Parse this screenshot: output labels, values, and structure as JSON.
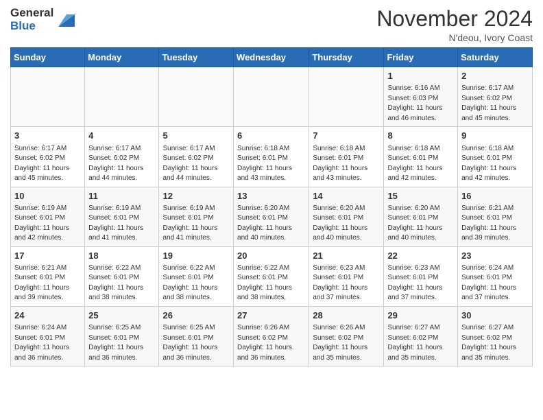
{
  "header": {
    "logo_general": "General",
    "logo_blue": "Blue",
    "month_title": "November 2024",
    "location": "N'deou, Ivory Coast"
  },
  "days_of_week": [
    "Sunday",
    "Monday",
    "Tuesday",
    "Wednesday",
    "Thursday",
    "Friday",
    "Saturday"
  ],
  "weeks": [
    {
      "days": [
        {
          "date": "",
          "info": ""
        },
        {
          "date": "",
          "info": ""
        },
        {
          "date": "",
          "info": ""
        },
        {
          "date": "",
          "info": ""
        },
        {
          "date": "",
          "info": ""
        },
        {
          "date": "1",
          "info": "Sunrise: 6:16 AM\nSunset: 6:03 PM\nDaylight: 11 hours\nand 46 minutes."
        },
        {
          "date": "2",
          "info": "Sunrise: 6:17 AM\nSunset: 6:02 PM\nDaylight: 11 hours\nand 45 minutes."
        }
      ]
    },
    {
      "days": [
        {
          "date": "3",
          "info": "Sunrise: 6:17 AM\nSunset: 6:02 PM\nDaylight: 11 hours\nand 45 minutes."
        },
        {
          "date": "4",
          "info": "Sunrise: 6:17 AM\nSunset: 6:02 PM\nDaylight: 11 hours\nand 44 minutes."
        },
        {
          "date": "5",
          "info": "Sunrise: 6:17 AM\nSunset: 6:02 PM\nDaylight: 11 hours\nand 44 minutes."
        },
        {
          "date": "6",
          "info": "Sunrise: 6:18 AM\nSunset: 6:01 PM\nDaylight: 11 hours\nand 43 minutes."
        },
        {
          "date": "7",
          "info": "Sunrise: 6:18 AM\nSunset: 6:01 PM\nDaylight: 11 hours\nand 43 minutes."
        },
        {
          "date": "8",
          "info": "Sunrise: 6:18 AM\nSunset: 6:01 PM\nDaylight: 11 hours\nand 42 minutes."
        },
        {
          "date": "9",
          "info": "Sunrise: 6:18 AM\nSunset: 6:01 PM\nDaylight: 11 hours\nand 42 minutes."
        }
      ]
    },
    {
      "days": [
        {
          "date": "10",
          "info": "Sunrise: 6:19 AM\nSunset: 6:01 PM\nDaylight: 11 hours\nand 42 minutes."
        },
        {
          "date": "11",
          "info": "Sunrise: 6:19 AM\nSunset: 6:01 PM\nDaylight: 11 hours\nand 41 minutes."
        },
        {
          "date": "12",
          "info": "Sunrise: 6:19 AM\nSunset: 6:01 PM\nDaylight: 11 hours\nand 41 minutes."
        },
        {
          "date": "13",
          "info": "Sunrise: 6:20 AM\nSunset: 6:01 PM\nDaylight: 11 hours\nand 40 minutes."
        },
        {
          "date": "14",
          "info": "Sunrise: 6:20 AM\nSunset: 6:01 PM\nDaylight: 11 hours\nand 40 minutes."
        },
        {
          "date": "15",
          "info": "Sunrise: 6:20 AM\nSunset: 6:01 PM\nDaylight: 11 hours\nand 40 minutes."
        },
        {
          "date": "16",
          "info": "Sunrise: 6:21 AM\nSunset: 6:01 PM\nDaylight: 11 hours\nand 39 minutes."
        }
      ]
    },
    {
      "days": [
        {
          "date": "17",
          "info": "Sunrise: 6:21 AM\nSunset: 6:01 PM\nDaylight: 11 hours\nand 39 minutes."
        },
        {
          "date": "18",
          "info": "Sunrise: 6:22 AM\nSunset: 6:01 PM\nDaylight: 11 hours\nand 38 minutes."
        },
        {
          "date": "19",
          "info": "Sunrise: 6:22 AM\nSunset: 6:01 PM\nDaylight: 11 hours\nand 38 minutes."
        },
        {
          "date": "20",
          "info": "Sunrise: 6:22 AM\nSunset: 6:01 PM\nDaylight: 11 hours\nand 38 minutes."
        },
        {
          "date": "21",
          "info": "Sunrise: 6:23 AM\nSunset: 6:01 PM\nDaylight: 11 hours\nand 37 minutes."
        },
        {
          "date": "22",
          "info": "Sunrise: 6:23 AM\nSunset: 6:01 PM\nDaylight: 11 hours\nand 37 minutes."
        },
        {
          "date": "23",
          "info": "Sunrise: 6:24 AM\nSunset: 6:01 PM\nDaylight: 11 hours\nand 37 minutes."
        }
      ]
    },
    {
      "days": [
        {
          "date": "24",
          "info": "Sunrise: 6:24 AM\nSunset: 6:01 PM\nDaylight: 11 hours\nand 36 minutes."
        },
        {
          "date": "25",
          "info": "Sunrise: 6:25 AM\nSunset: 6:01 PM\nDaylight: 11 hours\nand 36 minutes."
        },
        {
          "date": "26",
          "info": "Sunrise: 6:25 AM\nSunset: 6:01 PM\nDaylight: 11 hours\nand 36 minutes."
        },
        {
          "date": "27",
          "info": "Sunrise: 6:26 AM\nSunset: 6:02 PM\nDaylight: 11 hours\nand 36 minutes."
        },
        {
          "date": "28",
          "info": "Sunrise: 6:26 AM\nSunset: 6:02 PM\nDaylight: 11 hours\nand 35 minutes."
        },
        {
          "date": "29",
          "info": "Sunrise: 6:27 AM\nSunset: 6:02 PM\nDaylight: 11 hours\nand 35 minutes."
        },
        {
          "date": "30",
          "info": "Sunrise: 6:27 AM\nSunset: 6:02 PM\nDaylight: 11 hours\nand 35 minutes."
        }
      ]
    }
  ]
}
